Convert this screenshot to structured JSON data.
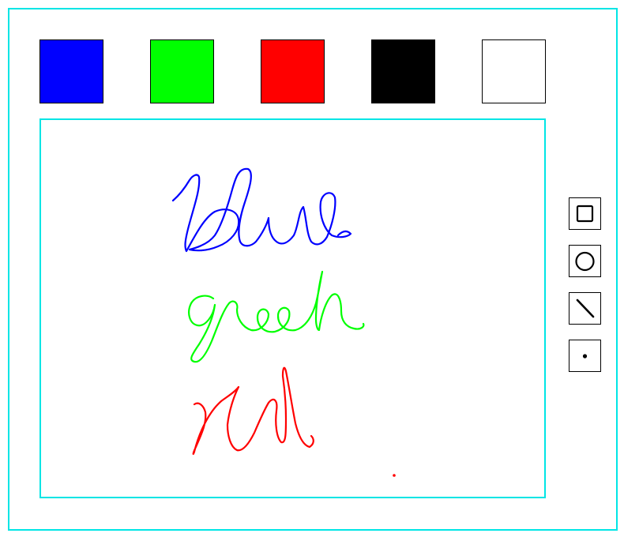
{
  "palette": {
    "swatches": [
      {
        "name": "blue",
        "color": "#0000ff"
      },
      {
        "name": "green",
        "color": "#00ff00"
      },
      {
        "name": "red",
        "color": "#ff0000"
      },
      {
        "name": "black",
        "color": "#000000"
      },
      {
        "name": "white",
        "color": "#ffffff"
      }
    ]
  },
  "tools": [
    {
      "id": "rectangle",
      "icon": "square-icon"
    },
    {
      "id": "circle",
      "icon": "circle-icon"
    },
    {
      "id": "line",
      "icon": "line-icon"
    },
    {
      "id": "point",
      "icon": "dot-icon"
    }
  ],
  "canvas": {
    "strokes": [
      {
        "word": "blue",
        "color": "#0000ff"
      },
      {
        "word": "green",
        "color": "#00ff00"
      },
      {
        "word": "red",
        "color": "#ff0000"
      }
    ],
    "dot_color": "#ff0000"
  },
  "theme": {
    "frame_color": "#00e5e5"
  }
}
